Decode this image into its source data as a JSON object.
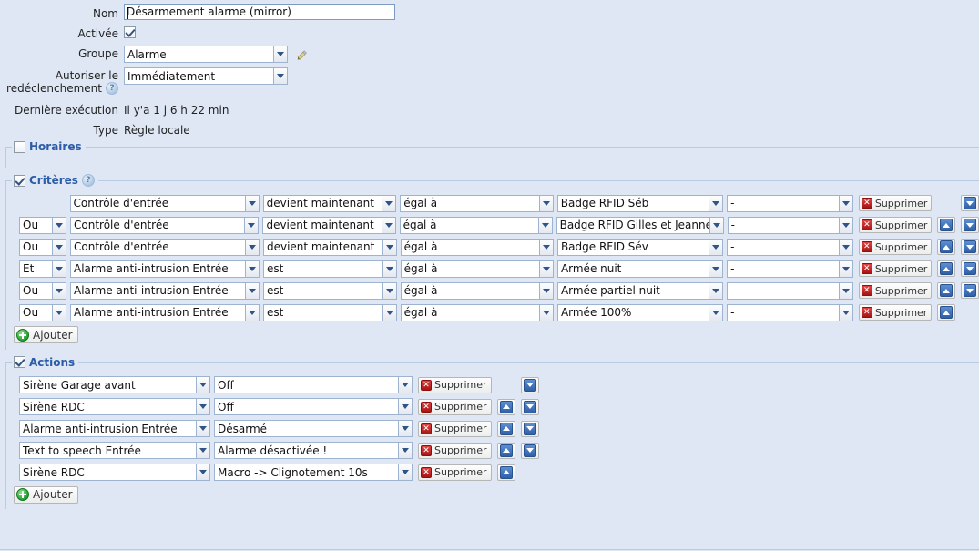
{
  "form": {
    "name_label": "Nom",
    "name_value": "Désarmement alarme (mirror)",
    "enabled_label": "Activée",
    "enabled_checked": true,
    "group_label": "Groupe",
    "group_value": "Alarme",
    "edit_group_icon": "pencil-icon",
    "retrigger_label_line1": "Autoriser le",
    "retrigger_label_line2": "redéclenchement",
    "retrigger_help_icon": "help-icon",
    "retrigger_value": "Immédiatement",
    "last_exec_label": "Dernière exécution",
    "last_exec_value": "Il y'a 1 j 6 h 22 min",
    "type_label": "Type",
    "type_value": "Règle locale"
  },
  "schedules": {
    "legend": "Horaires",
    "checked": false
  },
  "criteria": {
    "legend": "Critères",
    "checked": true,
    "help_icon": "help-icon",
    "add_label": "Ajouter",
    "delete_label": "Supprimer",
    "move_up_icon": "arrow-up-icon",
    "move_down_icon": "arrow-down-icon",
    "rows": [
      {
        "operator": "",
        "device": "Contrôle d'entrée",
        "condition": "devient maintenant",
        "comparator": "égal à",
        "value": "Badge RFID Séb",
        "extra": "-",
        "has_up": false,
        "has_down": true
      },
      {
        "operator": "Ou",
        "device": "Contrôle d'entrée",
        "condition": "devient maintenant",
        "comparator": "égal à",
        "value": "Badge RFID Gilles et Jeanne",
        "extra": "-",
        "has_up": true,
        "has_down": true
      },
      {
        "operator": "Ou",
        "device": "Contrôle d'entrée",
        "condition": "devient maintenant",
        "comparator": "égal à",
        "value": "Badge RFID Sév",
        "extra": "-",
        "has_up": true,
        "has_down": true
      },
      {
        "operator": "Et",
        "device": "Alarme anti-intrusion Entrée",
        "condition": "est",
        "comparator": "égal à",
        "value": "Armée nuit",
        "extra": "-",
        "has_up": true,
        "has_down": true
      },
      {
        "operator": "Ou",
        "device": "Alarme anti-intrusion Entrée",
        "condition": "est",
        "comparator": "égal à",
        "value": "Armée partiel nuit",
        "extra": "-",
        "has_up": true,
        "has_down": true
      },
      {
        "operator": "Ou",
        "device": "Alarme anti-intrusion Entrée",
        "condition": "est",
        "comparator": "égal à",
        "value": "Armée 100%",
        "extra": "-",
        "has_up": true,
        "has_down": false
      }
    ]
  },
  "actions": {
    "legend": "Actions",
    "checked": true,
    "add_label": "Ajouter",
    "delete_label": "Supprimer",
    "move_up_icon": "arrow-up-icon",
    "move_down_icon": "arrow-down-icon",
    "rows": [
      {
        "device": "Sirène Garage avant",
        "action": "Off",
        "has_up": false,
        "has_down": true
      },
      {
        "device": "Sirène RDC",
        "action": "Off",
        "has_up": true,
        "has_down": true
      },
      {
        "device": "Alarme anti-intrusion Entrée",
        "action": "Désarmé",
        "has_up": true,
        "has_down": true
      },
      {
        "device": "Text to speech Entrée",
        "action": "Alarme désactivée !",
        "has_up": true,
        "has_down": true
      },
      {
        "device": "Sirène RDC",
        "action": "Macro -> Clignotement 10s",
        "has_up": true,
        "has_down": false
      }
    ]
  }
}
